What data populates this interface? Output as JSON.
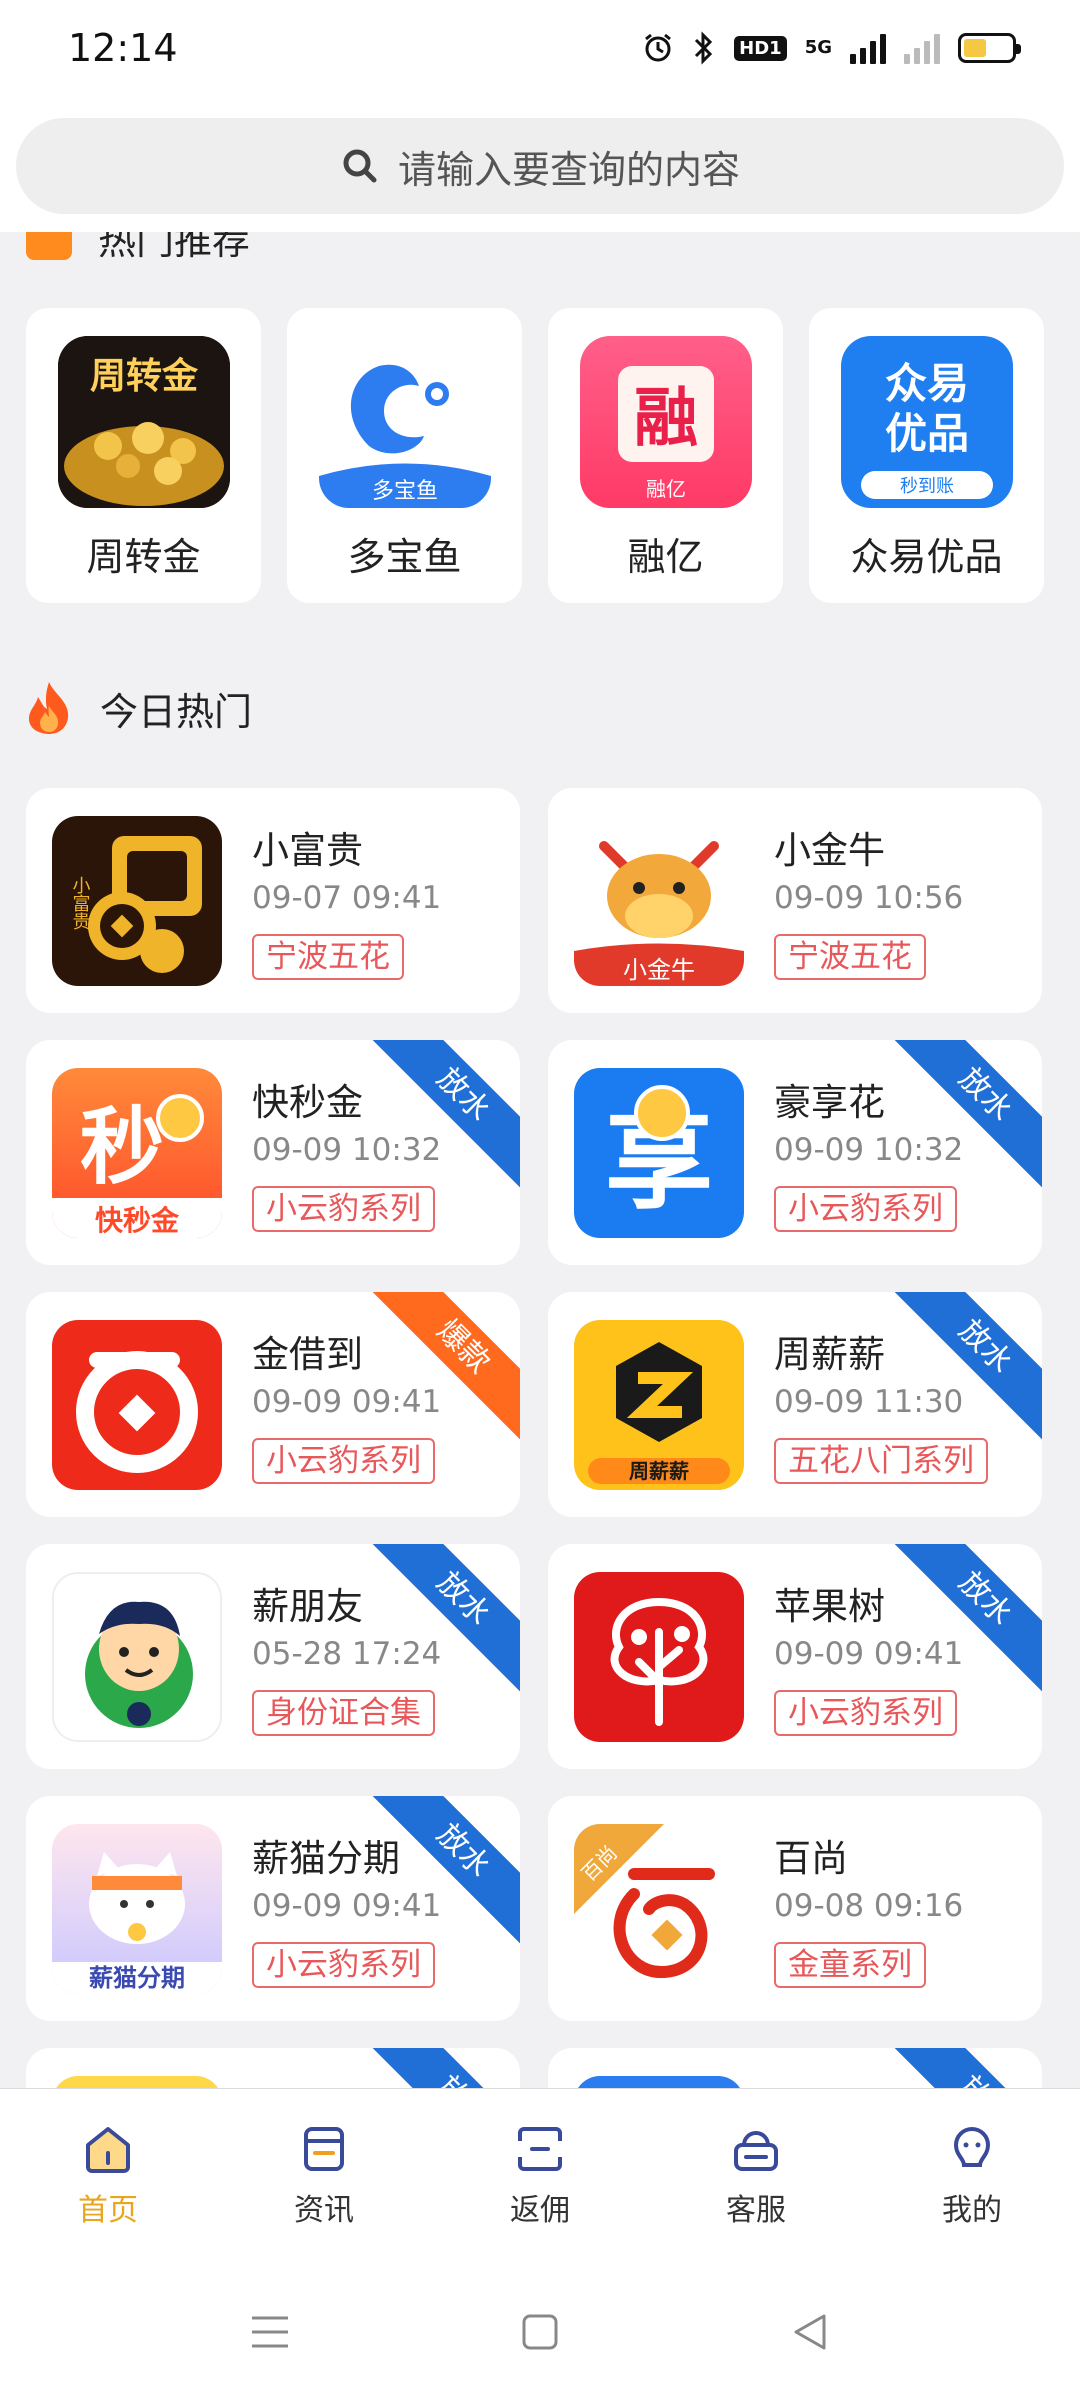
{
  "status": {
    "time": "12:14",
    "network": "5G",
    "hd": "HD1",
    "icons": [
      "alarm-icon",
      "bluetooth-icon",
      "hd-icon",
      "signal-icon",
      "signal-weak-icon",
      "battery-icon"
    ],
    "battery_color": "#f4c842"
  },
  "search": {
    "placeholder": "请输入要查询的内容"
  },
  "section_top": {
    "title": "热门推荐"
  },
  "top_apps": [
    {
      "name": "周转金",
      "logo_text": "周转金"
    },
    {
      "name": "多宝鱼",
      "logo_text": "多宝鱼"
    },
    {
      "name": "融亿",
      "logo_text": "融",
      "logo_sub": "融亿"
    },
    {
      "name": "众易优品",
      "logo_text": "众易",
      "logo_text2": "优品",
      "logo_sub": "秒到账"
    }
  ],
  "section_hot": {
    "title": "今日热门"
  },
  "hot_list": [
    {
      "name": "小富贵",
      "date": "09-07 09:41",
      "tag": "宁波五花",
      "ribbon": "",
      "logo_text": "小富贵"
    },
    {
      "name": "小金牛",
      "date": "09-09 10:56",
      "tag": "宁波五花",
      "ribbon": "",
      "logo_text": "小金牛"
    },
    {
      "name": "快秒金",
      "date": "09-09 10:32",
      "tag": "小云豹系列",
      "ribbon": "放水",
      "logo_text": "秒",
      "logo_sub": "快秒金"
    },
    {
      "name": "豪享花",
      "date": "09-09 10:32",
      "tag": "小云豹系列",
      "ribbon": "放水",
      "logo_text": "享"
    },
    {
      "name": "金借到",
      "date": "09-09 09:41",
      "tag": "小云豹系列",
      "ribbon": "爆款",
      "logo_text": ""
    },
    {
      "name": "周薪薪",
      "date": "09-09 11:30",
      "tag": "五花八门系列",
      "ribbon": "放水",
      "logo_text": "周薪薪"
    },
    {
      "name": "薪朋友",
      "date": "05-28 17:24",
      "tag": "身份证合集",
      "ribbon": "放水",
      "logo_text": ""
    },
    {
      "name": "苹果树",
      "date": "09-09 09:41",
      "tag": "小云豹系列",
      "ribbon": "放水",
      "logo_text": ""
    },
    {
      "name": "薪猫分期",
      "date": "09-09 09:41",
      "tag": "小云豹系列",
      "ribbon": "放水",
      "logo_text": "薪猫分期"
    },
    {
      "name": "百尚",
      "date": "09-08 09:16",
      "tag": "金童系列",
      "ribbon": "",
      "logo_text": "百尚"
    },
    {
      "name": "",
      "date": "",
      "tag": "",
      "ribbon": "放水",
      "logo_text": ""
    },
    {
      "name": "",
      "date": "",
      "tag": "",
      "ribbon": "放水",
      "logo_text": ""
    }
  ],
  "tabs": [
    {
      "label": "首页",
      "active": true
    },
    {
      "label": "资讯",
      "active": false
    },
    {
      "label": "返佣",
      "active": false
    },
    {
      "label": "客服",
      "active": false
    },
    {
      "label": "我的",
      "active": false
    }
  ],
  "colors": {
    "accent": "#e8a620",
    "ribbon_blue": "#1f6fd6",
    "ribbon_orange": "#ff6a1e",
    "tag_red": "#e8585a"
  }
}
